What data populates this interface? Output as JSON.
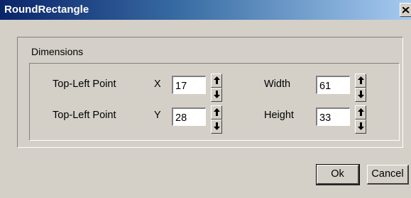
{
  "window": {
    "title": "RoundRectangle"
  },
  "group": {
    "label": "Dimensions"
  },
  "rows": [
    {
      "label": "Top-Left Point",
      "axis": "X",
      "axis_value": "17",
      "size_label": "Width",
      "size_value": "61"
    },
    {
      "label": "Top-Left Point",
      "axis": "Y",
      "axis_value": "28",
      "size_label": "Height",
      "size_value": "33"
    }
  ],
  "buttons": {
    "ok": "Ok",
    "cancel": "Cancel"
  },
  "icons": {
    "close": "close-icon",
    "spin_up": "arrow-up-icon",
    "spin_down": "arrow-down-icon"
  }
}
